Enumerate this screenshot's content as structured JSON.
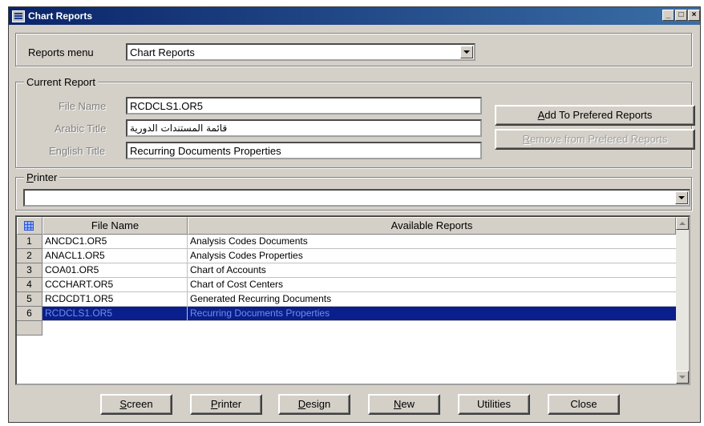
{
  "window": {
    "title": "Chart Reports"
  },
  "reports_menu": {
    "label": "Reports menu",
    "value": "Chart Reports"
  },
  "current_report": {
    "group_label": "Current Report",
    "file_name_label": "File Name",
    "file_name_value": "RCDCLS1.OR5",
    "arabic_title_label": "Arabic Title",
    "arabic_title_value": "قائمة المستندات الدورية",
    "english_title_label": "English Title",
    "english_title_value": "Recurring Documents Properties"
  },
  "buttons_side": {
    "add": {
      "accel": "A",
      "rest": "dd To Prefered Reports"
    },
    "remove": {
      "accel": "R",
      "rest": "emove from Prefered Reports"
    }
  },
  "printer": {
    "group_label_accel": "P",
    "group_label_rest": "rinter",
    "value": ""
  },
  "grid": {
    "columns": [
      "File Name",
      "Available Reports"
    ],
    "rows": [
      {
        "num": "1",
        "file": "ANCDC1.OR5",
        "report": "Analysis Codes Documents"
      },
      {
        "num": "2",
        "file": "ANACL1.OR5",
        "report": "Analysis Codes Properties"
      },
      {
        "num": "3",
        "file": "COA01.OR5",
        "report": "Chart of Accounts"
      },
      {
        "num": "4",
        "file": "CCCHART.OR5",
        "report": "Chart of Cost Centers"
      },
      {
        "num": "5",
        "file": "RCDCDT1.OR5",
        "report": "Generated Recurring Documents"
      },
      {
        "num": "6",
        "file": "RCDCLS1.OR5",
        "report": "Recurring Documents Properties"
      }
    ],
    "selected_index": 5
  },
  "bottom_buttons": {
    "screen": {
      "accel": "S",
      "rest": "creen"
    },
    "printer": {
      "accel": "P",
      "rest": "rinter"
    },
    "design": {
      "accel": "D",
      "rest": "esign"
    },
    "new": {
      "accel": "N",
      "rest": "ew"
    },
    "utilities": {
      "label": "Utilities"
    },
    "close": {
      "label": "Close"
    }
  },
  "colors": {
    "title_bar": "#0a246a",
    "selection": "#0a1e8c",
    "face": "#d4d0c8"
  }
}
